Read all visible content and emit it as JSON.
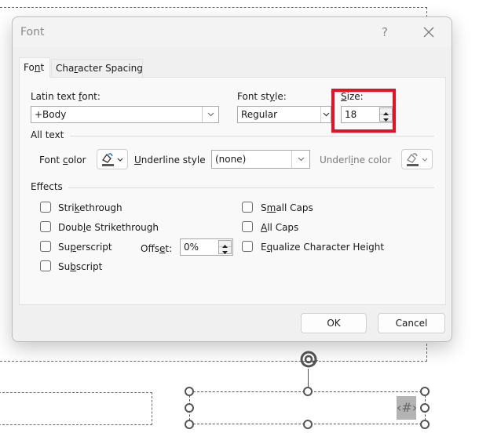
{
  "dialog": {
    "title": "Font",
    "help_label": "?",
    "close_icon": "close-icon",
    "tabs": [
      {
        "label_pre": "Fo",
        "label_key": "n",
        "label_post": "t",
        "active": true
      },
      {
        "label_pre": "Cha",
        "label_key": "r",
        "label_post": "acter Spacing",
        "active": false
      }
    ],
    "latin_font": {
      "label_pre": "Latin text ",
      "label_key": "f",
      "label_post": "ont:",
      "value": "+Body"
    },
    "font_style": {
      "label_pre": "Font st",
      "label_key": "y",
      "label_post": "le:",
      "value": "Regular"
    },
    "size": {
      "label_key": "S",
      "label_post": "ize:",
      "value": "18",
      "highlight_color": "#e81123"
    },
    "all_text": {
      "section_label": "All text",
      "font_color": {
        "label_pre": "Font ",
        "label_key": "c",
        "label_post": "olor",
        "icon": "paint-bucket-icon"
      },
      "underline_style": {
        "label_key": "U",
        "label_post": "nderline style",
        "value": "(none)"
      },
      "underline_color": {
        "label_pre": "Underl",
        "label_key": "i",
        "label_post": "ne color",
        "icon": "paint-bucket-icon",
        "enabled": false
      }
    },
    "effects": {
      "section_label": "Effects",
      "left": [
        {
          "pre": "Stri",
          "key": "k",
          "post": "ethrough",
          "checked": false
        },
        {
          "pre": "Doub",
          "key": "l",
          "post": "e Strikethrough",
          "checked": false
        },
        {
          "pre": "Su",
          "key": "p",
          "post": "erscript",
          "checked": false
        },
        {
          "pre": "Su",
          "key": "b",
          "post": "script",
          "checked": false
        }
      ],
      "right": [
        {
          "pre": "S",
          "key": "m",
          "post": "all Caps",
          "checked": false
        },
        {
          "pre": "",
          "key": "A",
          "post": "ll Caps",
          "checked": false
        },
        {
          "pre": "E",
          "key": "q",
          "post": "ualize Character Height",
          "checked": false
        }
      ],
      "offset": {
        "label_pre": "Offs",
        "label_key": "e",
        "label_post": "t:",
        "value": "0%"
      }
    },
    "buttons": {
      "ok": "OK",
      "cancel": "Cancel"
    }
  },
  "slide": {
    "slide_number_placeholder": "‹#›"
  }
}
